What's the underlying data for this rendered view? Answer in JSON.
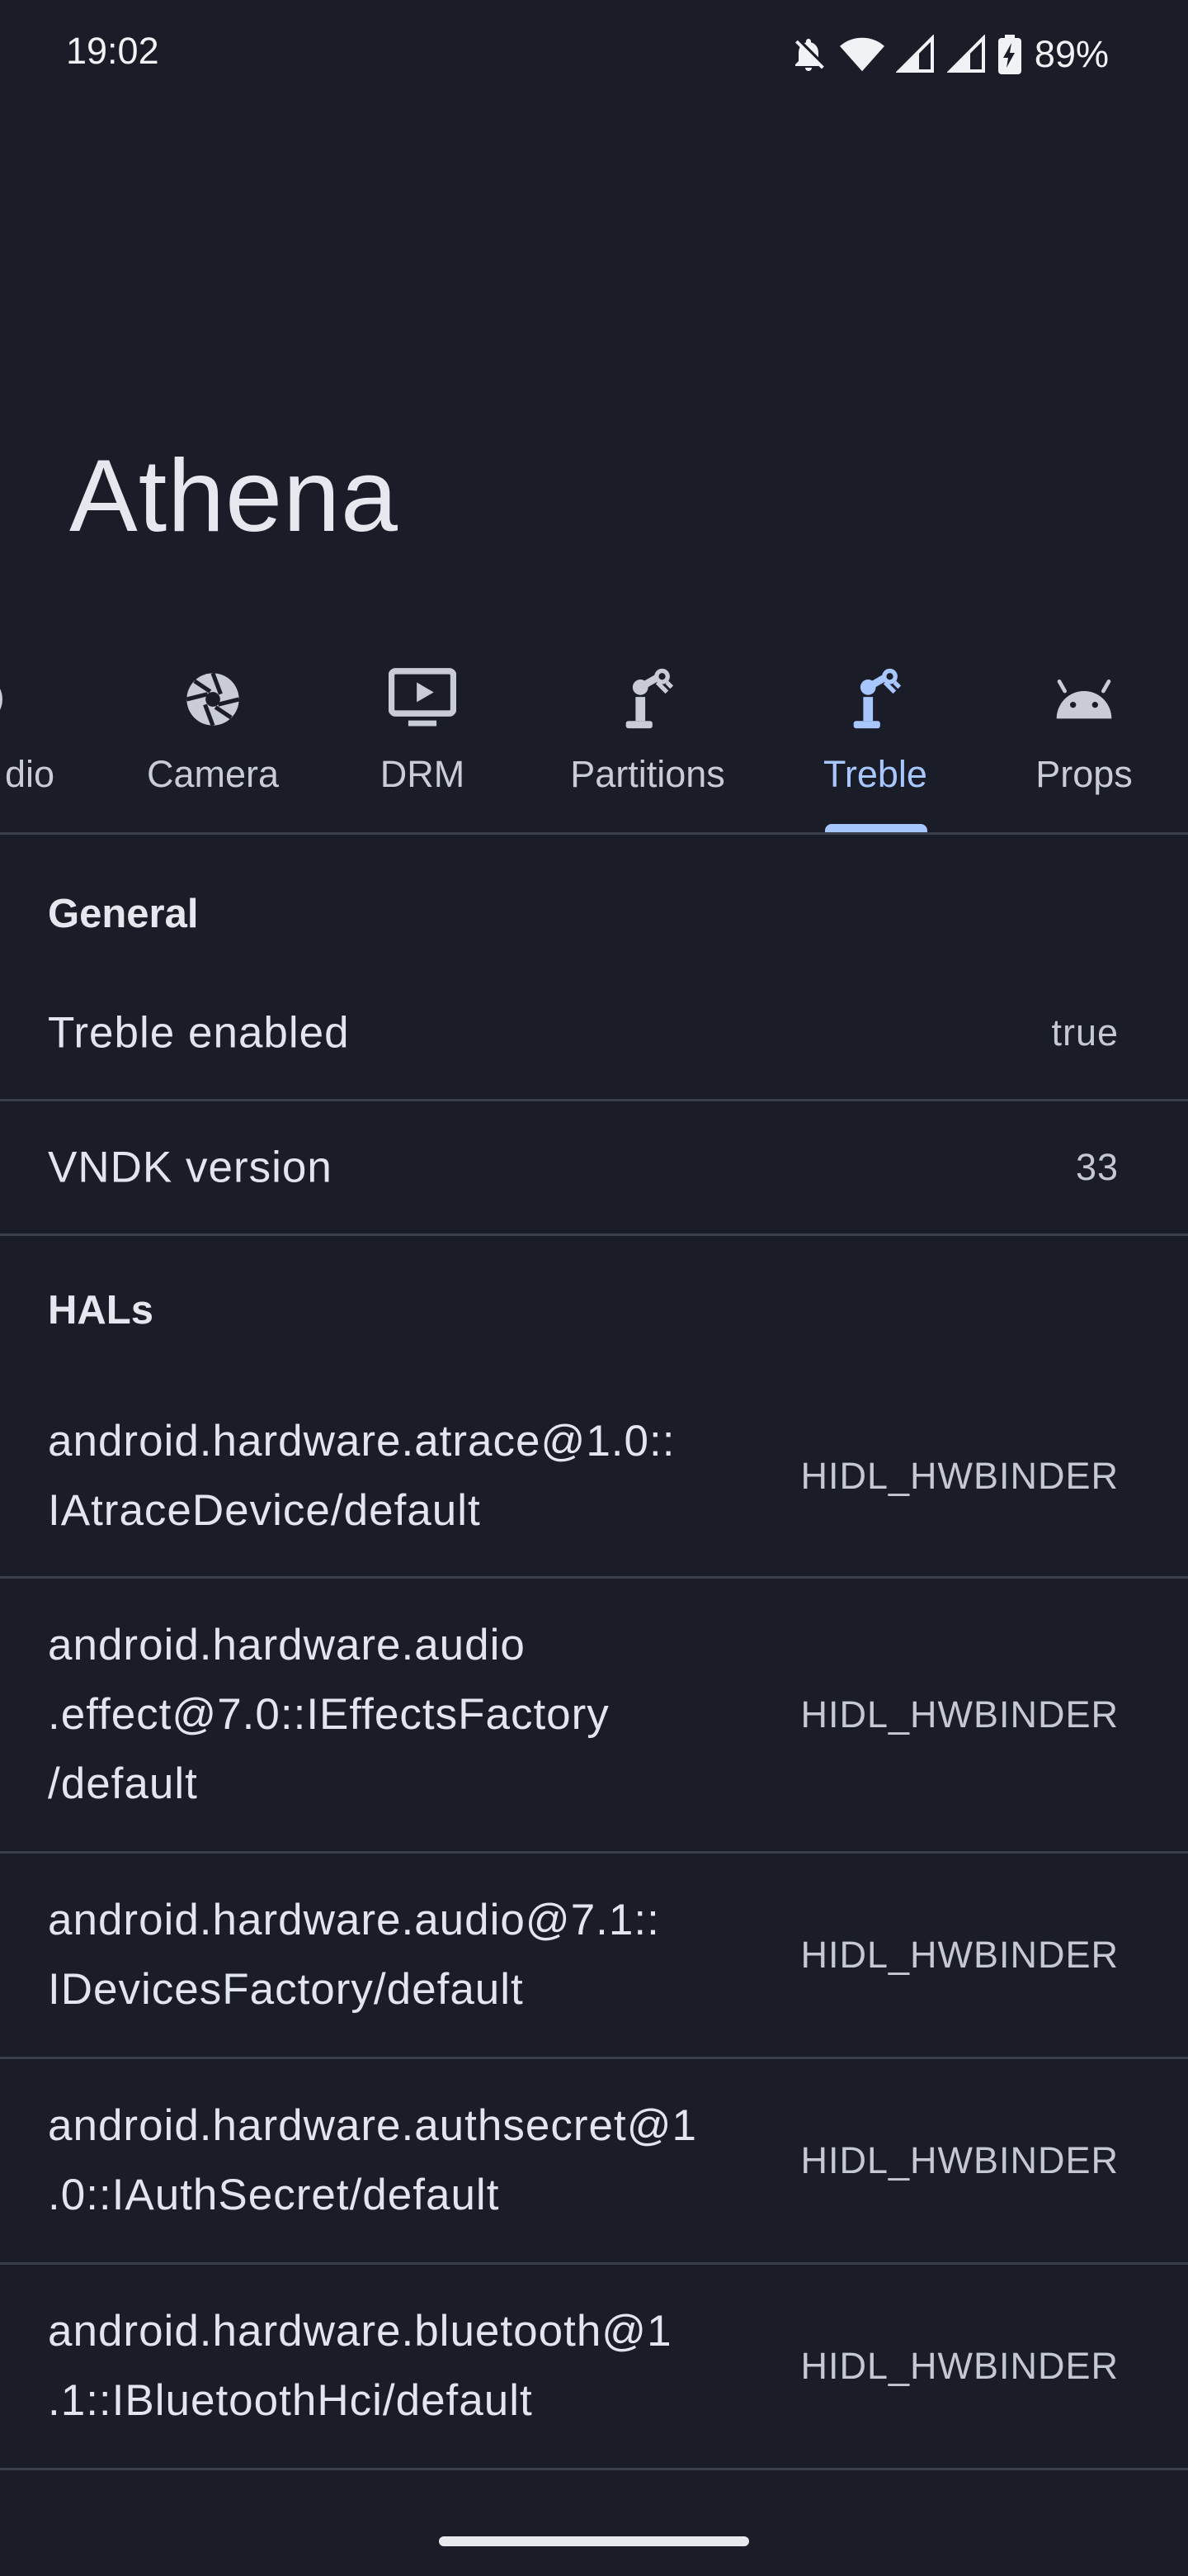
{
  "status": {
    "time": "19:02",
    "battery_percent": "89%"
  },
  "app": {
    "title": "Athena"
  },
  "tabs": [
    {
      "label": "dio",
      "icon": "audio-icon",
      "active": false
    },
    {
      "label": "Camera",
      "icon": "camera-aperture-icon",
      "active": false
    },
    {
      "label": "DRM",
      "icon": "drm-play-icon",
      "active": false
    },
    {
      "label": "Partitions",
      "icon": "robot-arm-icon",
      "active": false
    },
    {
      "label": "Treble",
      "icon": "robot-arm-icon",
      "active": true
    },
    {
      "label": "Props",
      "icon": "android-icon",
      "active": false
    }
  ],
  "general": {
    "title": "General",
    "rows": [
      {
        "key": "Treble enabled",
        "value": "true"
      },
      {
        "key": "VNDK version",
        "value": "33"
      }
    ]
  },
  "hals": {
    "title": "HALs",
    "rows": [
      {
        "lines": [
          "android.hardware.atrace@1.0::",
          "IAtraceDevice/default"
        ],
        "value": "HIDL_HWBINDER"
      },
      {
        "lines": [
          "android.hardware.audio",
          ".effect@7.0::IEffectsFactory",
          "/default"
        ],
        "value": "HIDL_HWBINDER"
      },
      {
        "lines": [
          "android.hardware.audio@7.1::",
          "IDevicesFactory/default"
        ],
        "value": "HIDL_HWBINDER"
      },
      {
        "lines": [
          "android.hardware.authsecret@1",
          ".0::IAuthSecret/default"
        ],
        "value": "HIDL_HWBINDER"
      },
      {
        "lines": [
          "android.hardware.bluetooth@1",
          ".1::IBluetoothHci/default"
        ],
        "value": "HIDL_HWBINDER"
      }
    ]
  },
  "colors": {
    "background": "#1a1d27",
    "accent": "#a9c7ff",
    "divider": "#3a3e4b"
  }
}
